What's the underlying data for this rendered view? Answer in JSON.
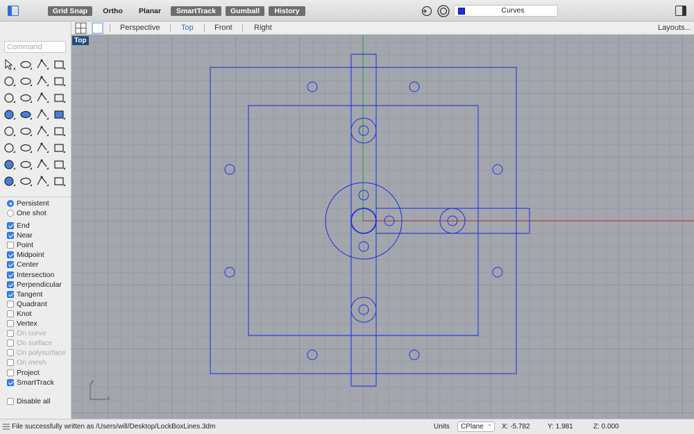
{
  "toolbar": {
    "buttons": [
      {
        "label": "Grid Snap",
        "active": true
      },
      {
        "label": "Ortho",
        "active": false
      },
      {
        "label": "Planar",
        "active": false
      },
      {
        "label": "SmartTrack",
        "active": true
      },
      {
        "label": "Gumball",
        "active": true
      },
      {
        "label": "History",
        "active": true
      }
    ],
    "layer_name": "Curves",
    "layer_color": "#1a2ee6"
  },
  "viewbar": {
    "tabs": [
      "Perspective",
      "Top",
      "Front",
      "Right"
    ],
    "active_tab": "Top",
    "layouts_label": "Layouts..."
  },
  "command": {
    "placeholder": "Command"
  },
  "tools": [
    "select-arrow",
    "point",
    "polyline",
    "curve-control-points",
    "circle",
    "ellipse",
    "polygon",
    "rectangle",
    "revolve",
    "rail-sweep",
    "surface-patch",
    "surface-edit",
    "box",
    "sphere",
    "cylinder",
    "extrude",
    "group",
    "explode",
    "trim",
    "split",
    "boolean",
    "array",
    "fillet",
    "move",
    "text",
    "dimension",
    "align",
    "mirror",
    "mesh",
    "layer-gauge",
    "grid-array",
    "gumball-axis"
  ],
  "osnap": {
    "modes": [
      {
        "label": "Persistent",
        "checked": true
      },
      {
        "label": "One shot",
        "checked": false
      }
    ],
    "items": [
      {
        "label": "End",
        "checked": true,
        "disabled": false
      },
      {
        "label": "Near",
        "checked": true,
        "disabled": false
      },
      {
        "label": "Point",
        "checked": false,
        "disabled": false
      },
      {
        "label": "Midpoint",
        "checked": true,
        "disabled": false
      },
      {
        "label": "Center",
        "checked": true,
        "disabled": false
      },
      {
        "label": "Intersection",
        "checked": true,
        "disabled": false
      },
      {
        "label": "Perpendicular",
        "checked": true,
        "disabled": false
      },
      {
        "label": "Tangent",
        "checked": true,
        "disabled": false
      },
      {
        "label": "Quadrant",
        "checked": false,
        "disabled": false
      },
      {
        "label": "Knot",
        "checked": false,
        "disabled": false
      },
      {
        "label": "Vertex",
        "checked": false,
        "disabled": false
      },
      {
        "label": "On curve",
        "checked": false,
        "disabled": true
      },
      {
        "label": "On surface",
        "checked": false,
        "disabled": true
      },
      {
        "label": "On polysurface",
        "checked": false,
        "disabled": true
      },
      {
        "label": "On mesh",
        "checked": false,
        "disabled": true
      },
      {
        "label": "Project",
        "checked": false,
        "disabled": false
      },
      {
        "label": "SmartTrack",
        "checked": true,
        "disabled": false
      }
    ],
    "disable_all": {
      "label": "Disable all",
      "checked": false
    }
  },
  "viewport": {
    "label": "Top",
    "axis_y": "y",
    "axis_x": "x",
    "curve_color": "#1a2ee6",
    "x_axis_color": "#b0303a",
    "y_axis_color": "#2f9b3f"
  },
  "status": {
    "message": "File successfully written as /Users/will/Desktop/LockBoxLines.3dm",
    "units_label": "Units",
    "cplane": "CPlane",
    "x": "X: -5.782",
    "y": "Y: 1.981",
    "z": "Z: 0.000"
  }
}
